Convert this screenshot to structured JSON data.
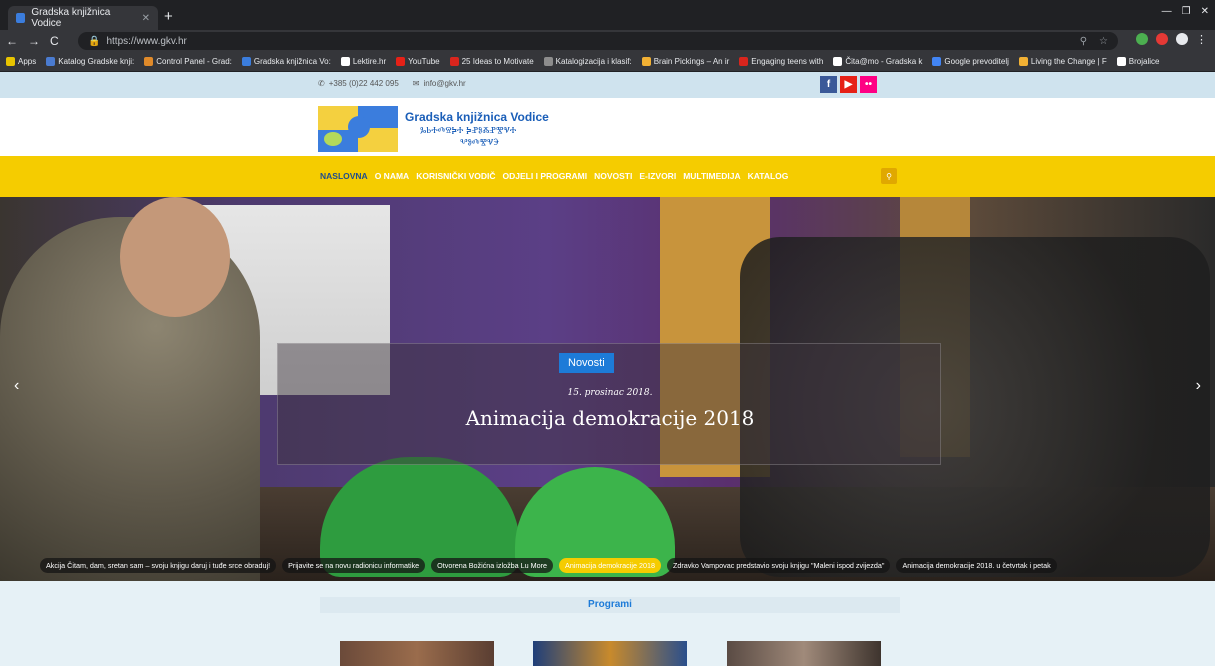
{
  "browser": {
    "tab_title": "Gradska knjižnica Vodice",
    "url": "https://www.gkv.hr",
    "bookmarks": [
      {
        "label": "Apps",
        "color": "#e8c400"
      },
      {
        "label": "Katalog Gradske knji:",
        "color": "#4a7bd0"
      },
      {
        "label": "Control Panel - Grad:",
        "color": "#e08a2a"
      },
      {
        "label": "Gradska knjižnica Vo:",
        "color": "#3b7ddd"
      },
      {
        "label": "Lektire.hr",
        "color": "#ffffff"
      },
      {
        "label": "YouTube",
        "color": "#e62117"
      },
      {
        "label": "25 Ideas to Motivate",
        "color": "#d9251d"
      },
      {
        "label": "Katalogizacija i klasif:",
        "color": "#8d8d8d"
      },
      {
        "label": "Brain Pickings – An ir",
        "color": "#f2b134"
      },
      {
        "label": "Engaging teens with",
        "color": "#d9251d"
      },
      {
        "label": "Čita@mo - Gradska k",
        "color": "#ffffff"
      },
      {
        "label": "Google prevoditelj",
        "color": "#4285f4"
      },
      {
        "label": "Living the Change | F",
        "color": "#f2b134"
      },
      {
        "label": "Brojalice",
        "color": "#ffffff"
      }
    ]
  },
  "site": {
    "phone": "+385 (0)22 442 095",
    "email": "info@gkv.hr",
    "title": "Gradska knjižnica Vodice",
    "title_glagolitic_1": "ⰃⰓⰀⰄⰔⰍⰀ ⰍⰐⰑⰆⰐⰊⰜⰀ",
    "title_glagolitic_2": "ⰂⰑⰄⰊⰜⰅ",
    "nav": [
      "NASLOVNA",
      "O NAMA",
      "KORISNIČKI VODIČ",
      "ODJELI I PROGRAMI",
      "NOVOSTI",
      "E-IZVORI",
      "MULTIMEDIJA",
      "KATALOG"
    ],
    "hero": {
      "category": "Novosti",
      "date": "15. prosinac 2018.",
      "headline": "Animacija demokracije 2018"
    },
    "slides": [
      "Akcija Čitam, dam, sretan sam – svoju knjigu daruj i tuđe srce obraduj!",
      "Prijavite se na novu radionicu informatike",
      "Otvorena Božićna izložba Lu More",
      "Animacija demokracije 2018",
      "Zdravko Vampovac predstavio svoju knjigu \"Maleni ispod zvijezda\"",
      "Animacija demokracije 2018. u četvrtak i petak"
    ],
    "active_slide": 3,
    "programs_heading": "Programi",
    "colors": {
      "accent": "#f5cc00",
      "brand_blue": "#1d7bd8"
    }
  }
}
